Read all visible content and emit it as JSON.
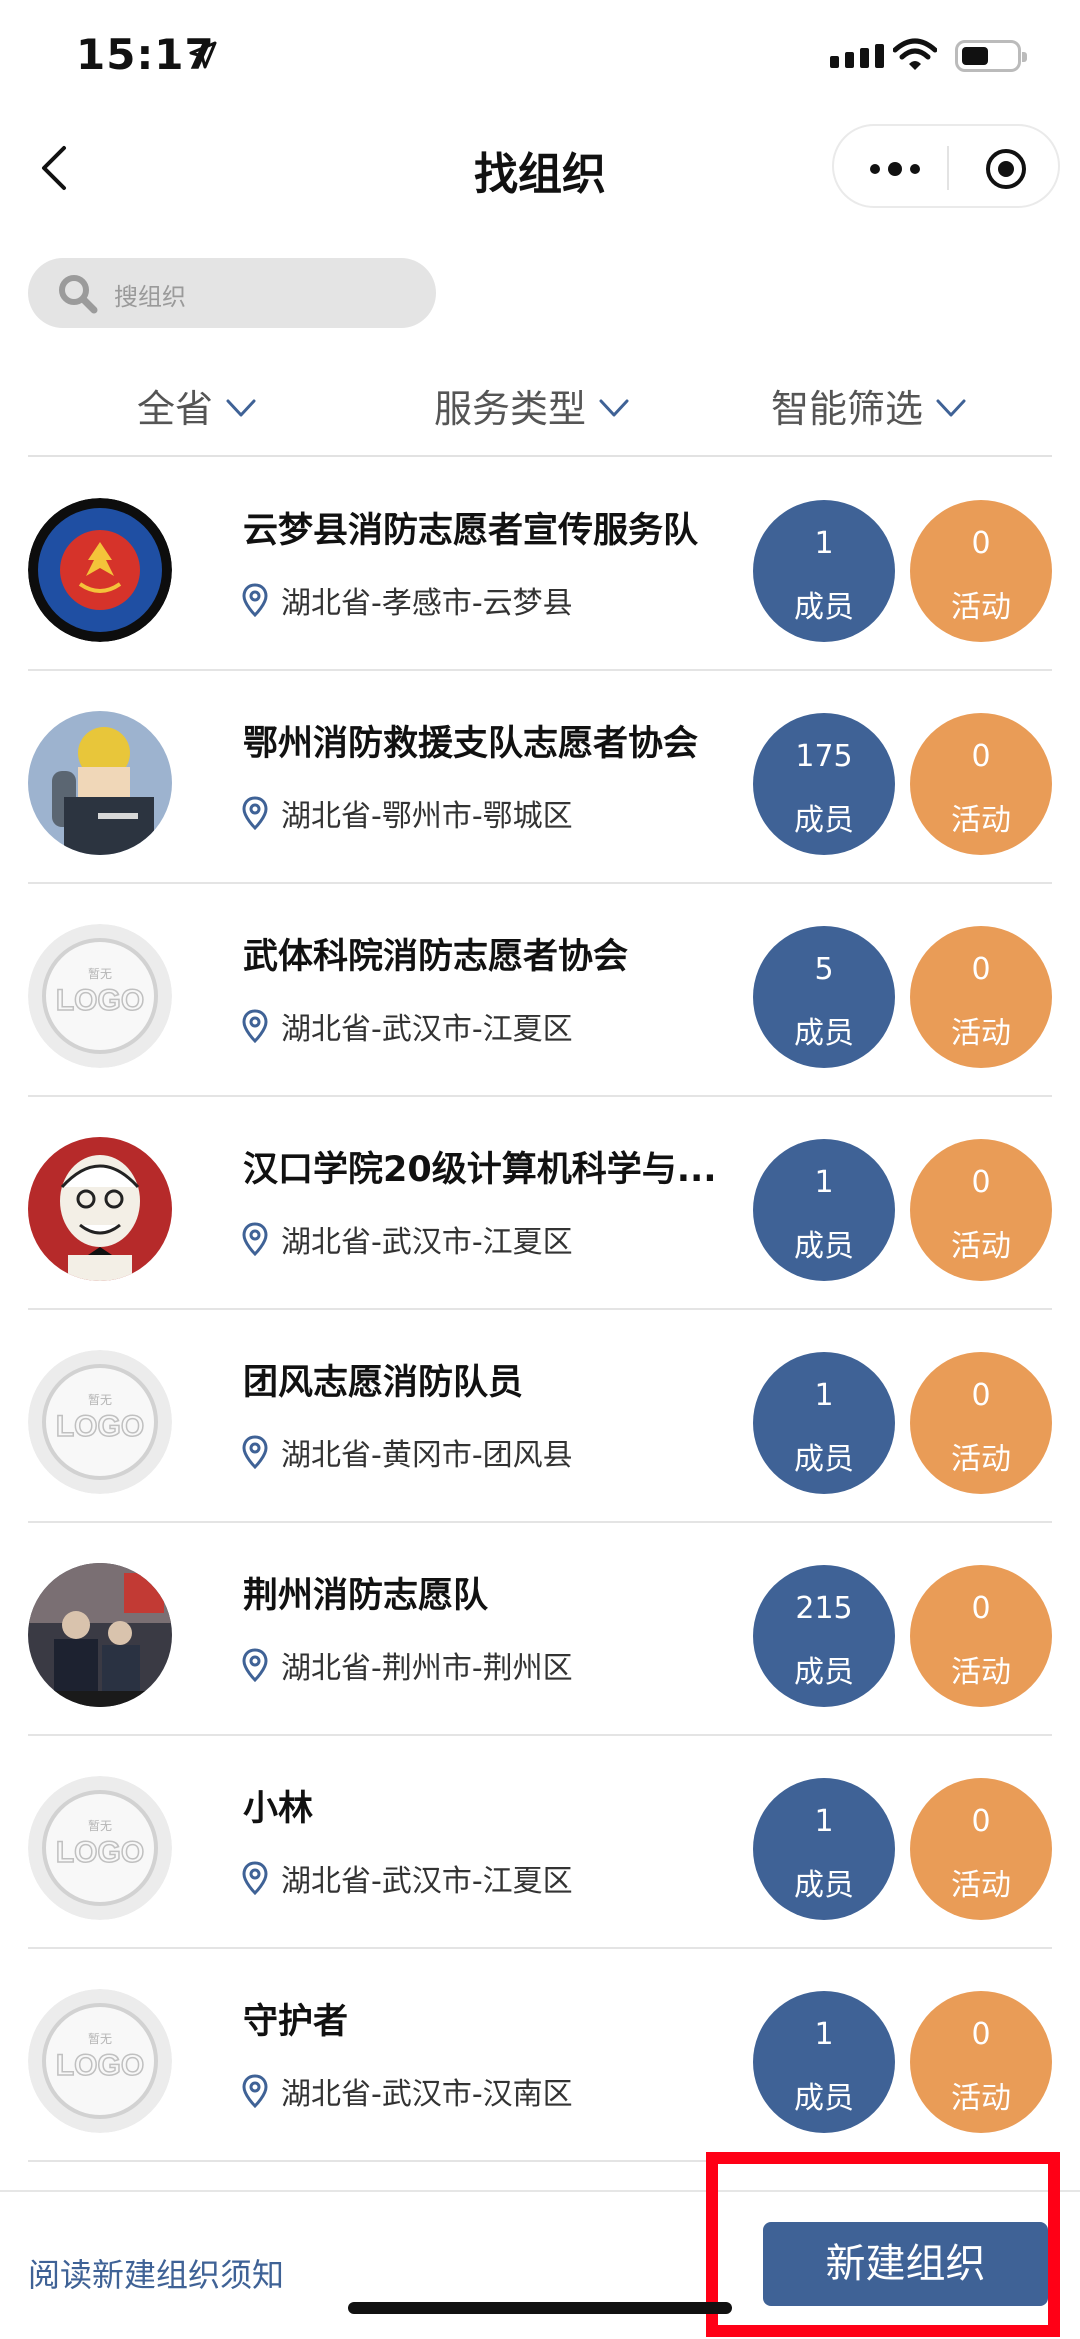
{
  "status_bar": {
    "time": "15:17"
  },
  "nav": {
    "title": "找组织"
  },
  "search": {
    "placeholder": "搜组织"
  },
  "filters": [
    {
      "label": "全省"
    },
    {
      "label": "服务类型"
    },
    {
      "label": "智能筛选"
    }
  ],
  "orgs": [
    {
      "name": "云梦县消防志愿者宣传服务队",
      "location": "湖北省-孝感市-云梦县",
      "members": "1",
      "members_label": "成员",
      "activities": "0",
      "activities_label": "活动",
      "avatar": "fire-volunteer-badge"
    },
    {
      "name": "鄂州消防救援支队志愿者协会",
      "location": "湖北省-鄂州市-鄂城区",
      "members": "175",
      "members_label": "成员",
      "activities": "0",
      "activities_label": "活动",
      "avatar": "firefighter-photo"
    },
    {
      "name": "武体科院消防志愿者协会",
      "location": "湖北省-武汉市-江夏区",
      "members": "5",
      "members_label": "成员",
      "activities": "0",
      "activities_label": "活动",
      "avatar": "no-logo",
      "logo_small": "暂无",
      "logo_text": "LOGO"
    },
    {
      "name": "汉口学院20级计算机科学与...",
      "location": "湖北省-武汉市-江夏区",
      "members": "1",
      "members_label": "成员",
      "activities": "0",
      "activities_label": "活动",
      "avatar": "cartoon-portrait"
    },
    {
      "name": "团风志愿消防队员",
      "location": "湖北省-黄冈市-团风县",
      "members": "1",
      "members_label": "成员",
      "activities": "0",
      "activities_label": "活动",
      "avatar": "no-logo",
      "logo_small": "暂无",
      "logo_text": "LOGO"
    },
    {
      "name": "荆州消防志愿队",
      "location": "湖北省-荆州市-荆州区",
      "members": "215",
      "members_label": "成员",
      "activities": "0",
      "activities_label": "活动",
      "avatar": "group-photo"
    },
    {
      "name": "小林",
      "location": "湖北省-武汉市-江夏区",
      "members": "1",
      "members_label": "成员",
      "activities": "0",
      "activities_label": "活动",
      "avatar": "no-logo",
      "logo_small": "暂无",
      "logo_text": "LOGO"
    },
    {
      "name": "守护者",
      "location": "湖北省-武汉市-汉南区",
      "members": "1",
      "members_label": "成员",
      "activities": "0",
      "activities_label": "活动",
      "avatar": "no-logo",
      "logo_small": "暂无",
      "logo_text": "LOGO"
    }
  ],
  "footer": {
    "notice_link": "阅读新建组织须知",
    "create_button": "新建组织"
  },
  "colors": {
    "primary": "#3f6296",
    "member_badge": "#3f6296",
    "activity_badge": "#e99c57",
    "highlight": "#ff0016"
  }
}
